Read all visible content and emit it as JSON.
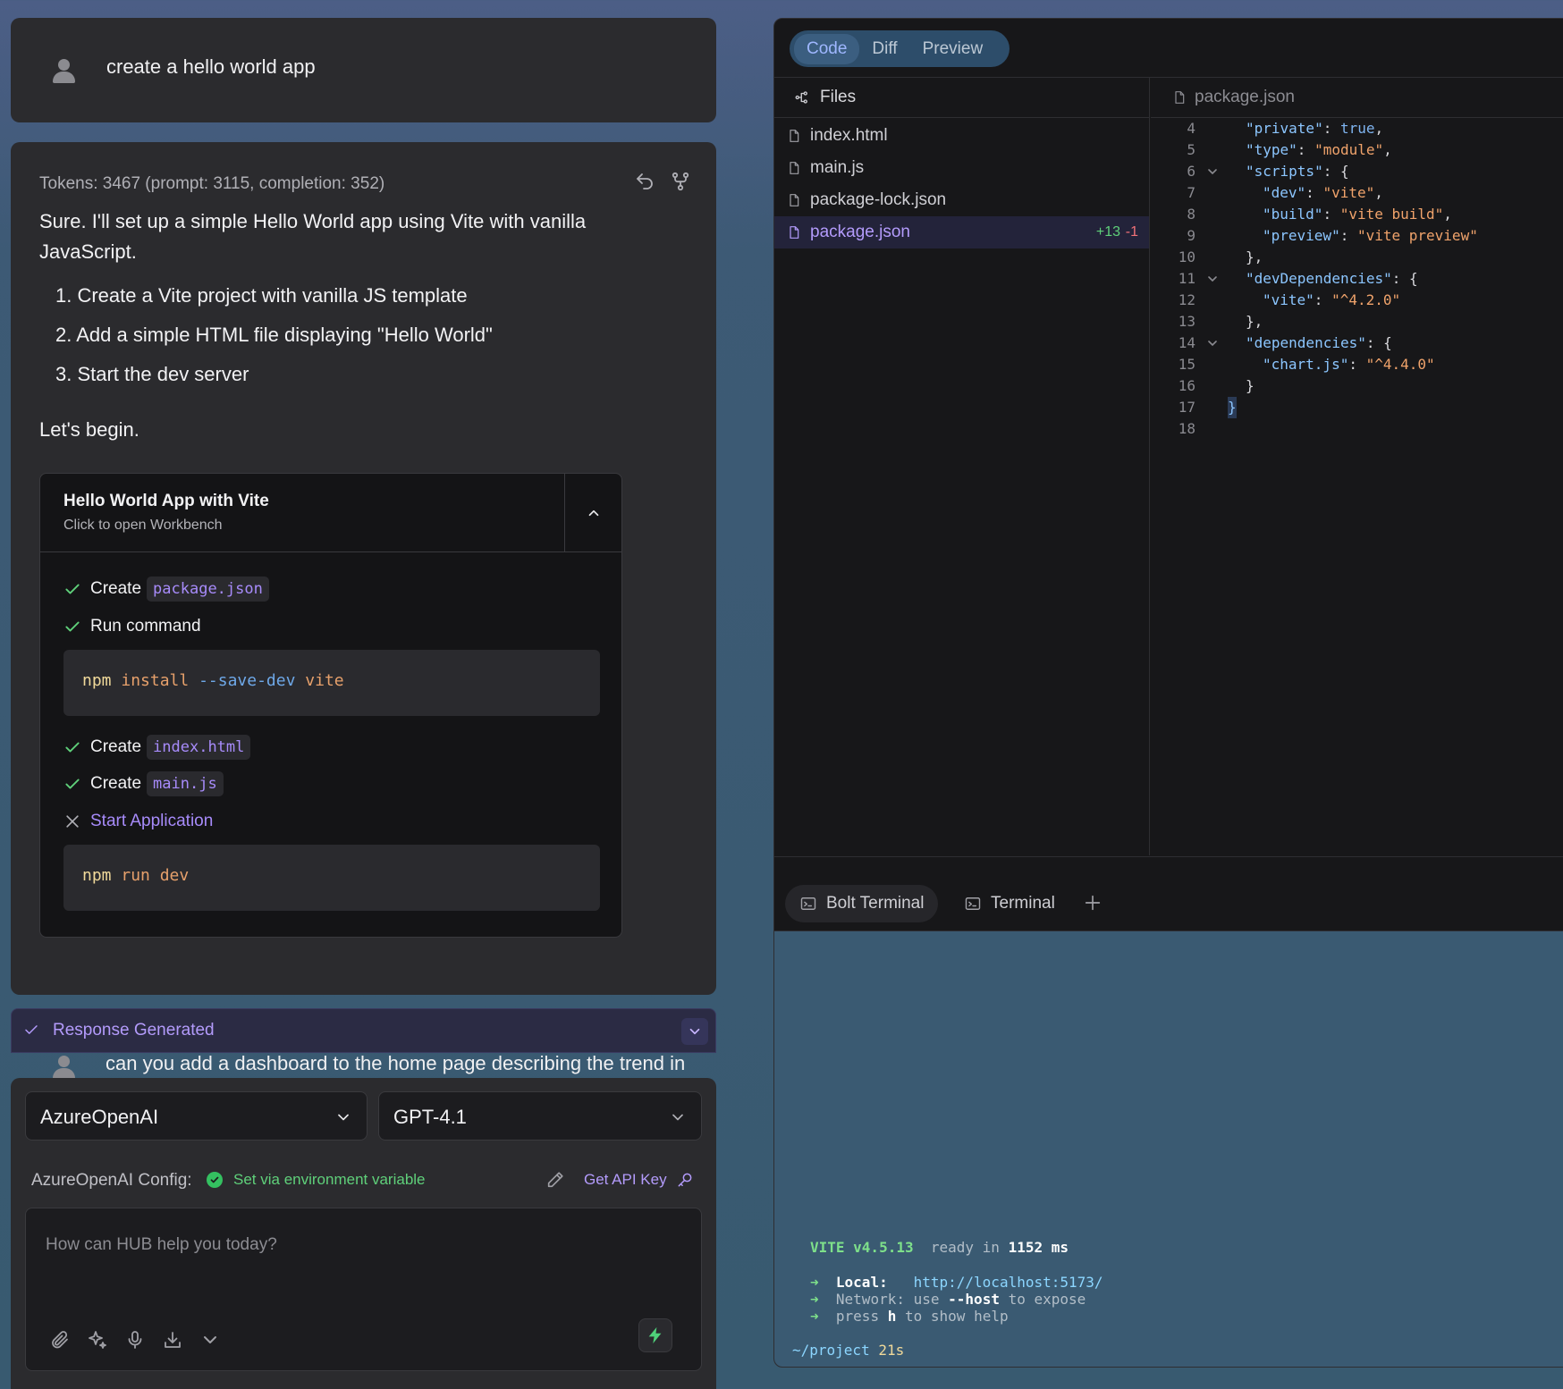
{
  "chat": {
    "user_message": "create a hello world app",
    "tokens": "Tokens: 3467 (prompt: 3115, completion: 352)",
    "reply_intro": "Sure. I'll set up a simple Hello World app using Vite with vanilla JavaScript.",
    "steps": [
      "1. Create a Vite project with vanilla JS template",
      "2. Add a simple HTML file displaying \"Hello World\"",
      "3. Start the dev server"
    ],
    "closing": "Let's begin.",
    "artifact": {
      "title": "Hello World App with Vite",
      "subtitle": "Click to open Workbench",
      "actions": [
        {
          "label": "Create",
          "chip": "package.json",
          "status": "done"
        },
        {
          "label": "Run command",
          "status": "done"
        },
        {
          "label": "Create",
          "chip": "index.html",
          "status": "done"
        },
        {
          "label": "Create",
          "chip": "main.js",
          "status": "done"
        },
        {
          "label": "Start Application",
          "status": "failed"
        }
      ],
      "cmd1": {
        "bin": "npm",
        "arg1": "install",
        "flag": "--save-dev",
        "arg2": "vite"
      },
      "cmd2": {
        "bin": "npm",
        "arg1": "run",
        "arg2": "dev"
      }
    },
    "status": "Response Generated",
    "next_message": "can you add a dashboard to the home page describing the trend in"
  },
  "input": {
    "provider": "AzureOpenAI",
    "model": "GPT-4.1",
    "config_label": "AzureOpenAI Config:",
    "config_status": "Set via environment variable",
    "api_key_link": "Get API Key",
    "placeholder": "How can HUB help you today?"
  },
  "workbench": {
    "tabs": [
      "Code",
      "Diff",
      "Preview"
    ],
    "active_tab": "Code",
    "files_header": "Files",
    "files": [
      "index.html",
      "main.js",
      "package-lock.json",
      "package.json"
    ],
    "selected_file": "package.json",
    "diff_add": "+13",
    "diff_del": "-1",
    "editor_file": "package.json",
    "line_numbers": [
      "4",
      "5",
      "6",
      "7",
      "8",
      "9",
      "10",
      "11",
      "12",
      "13",
      "14",
      "15",
      "16",
      "17",
      "18"
    ],
    "code": {
      "l4k": "\"private\"",
      "l4v": "true",
      "l5k": "\"type\"",
      "l5v": "\"module\"",
      "l6k": "\"scripts\"",
      "l7k": "\"dev\"",
      "l7v": "\"vite\"",
      "l8k": "\"build\"",
      "l8v": "\"vite build\"",
      "l9k": "\"preview\"",
      "l9v": "\"vite preview\"",
      "l11k": "\"devDependencies\"",
      "l12k": "\"vite\"",
      "l12v": "\"^4.2.0\"",
      "l14k": "\"dependencies\"",
      "l15k": "\"chart.js\"",
      "l15v": "\"^4.4.0\""
    },
    "terminal_tabs": [
      "Bolt Terminal",
      "Terminal"
    ],
    "terminal": {
      "vite": "VITE v4.5.13",
      "ready": "ready in",
      "ready_ms": "1152",
      "ms": "ms",
      "local_label": "Local:",
      "local_url": "http://localhost:5173/",
      "network_label": "Network:",
      "network_text_1": "use",
      "network_flag": "--host",
      "network_text_2": "to expose",
      "help_1": "press",
      "help_key": "h",
      "help_2": "to show help",
      "prompt": "~/project",
      "elapsed": "21s"
    }
  },
  "colors": {
    "accent": "#a78bfa",
    "success": "#5fd07a",
    "panel": "#2b2b2e",
    "terminal_bg": "#3a5a72"
  }
}
